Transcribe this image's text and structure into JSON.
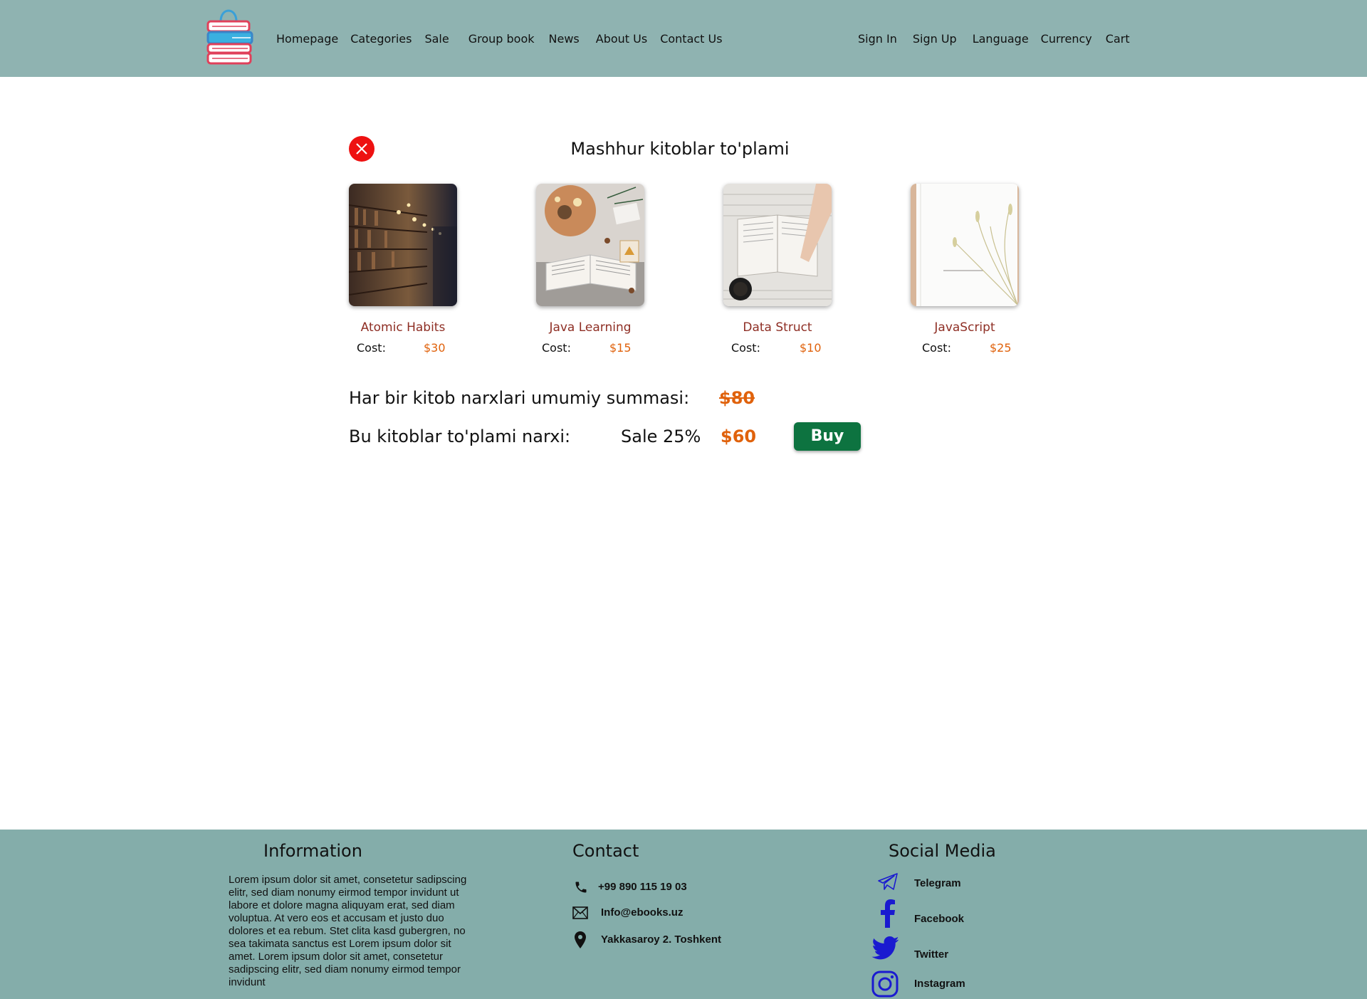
{
  "header": {
    "nav_left": [
      "Homepage",
      "Categories",
      "Sale",
      "Group book",
      "News",
      "About Us",
      "Contact Us"
    ],
    "nav_right": [
      "Sign In",
      "Sign Up",
      "Language",
      "Currency",
      "Cart"
    ]
  },
  "main": {
    "title": "Mashhur kitoblar to'plami",
    "books": [
      {
        "title": "Atomic Habits",
        "cost_label": "Cost:",
        "price": "$30"
      },
      {
        "title": "Java Learning",
        "cost_label": "Cost:",
        "price": "$15"
      },
      {
        "title": "Data Struct",
        "cost_label": "Cost:",
        "price": "$10"
      },
      {
        "title": "JavaScript",
        "cost_label": "Cost:",
        "price": "$25"
      }
    ],
    "sum_label": "Har bir kitob narxlari umumiy summasi:",
    "sum_value": "$80",
    "set_label": "Bu kitoblar to'plami narxi:",
    "sale_label": "Sale 25%",
    "sale_price": "$60",
    "buy_label": "Buy"
  },
  "footer": {
    "information": {
      "heading": "Information",
      "text": "Lorem ipsum dolor sit amet, consetetur sadipscing elitr, sed diam nonumy eirmod tempor invidunt ut labore et dolore magna aliquyam erat, sed diam voluptua. At vero eos et accusam et justo duo dolores et ea rebum. Stet clita kasd gubergren, no sea takimata sanctus est Lorem ipsum dolor sit amet. Lorem ipsum dolor sit amet, consetetur sadipscing elitr, sed diam nonumy eirmod tempor invidunt"
    },
    "contact": {
      "heading": "Contact",
      "phone": "+99 890 115 19 03",
      "email": "Info@ebooks.uz",
      "address": "Yakkasaroy 2. Toshkent"
    },
    "social": {
      "heading": "Social Media",
      "items": [
        "Telegram",
        "Facebook",
        "Twitter",
        "Instagram"
      ]
    }
  },
  "colors": {
    "header_bg": "#8fb3b1",
    "footer_bg": "#84adaa",
    "book_title": "#8e2e24",
    "price": "#e0620c",
    "buy_button": "#0d7340",
    "close_button": "#ee1111",
    "social_icons": "#1a1ad0"
  },
  "icons": [
    "shopping-bag-books-logo",
    "close-icon",
    "phone-icon",
    "mail-icon",
    "location-pin-icon",
    "telegram-icon",
    "facebook-icon",
    "twitter-icon",
    "instagram-icon"
  ]
}
